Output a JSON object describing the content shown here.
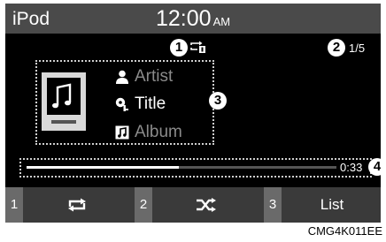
{
  "header": {
    "app_title": "iPod",
    "time": "12:00",
    "ampm": "AM"
  },
  "status": {
    "repeat_icon": "repeat-one-icon",
    "track_counter": "1/5"
  },
  "callouts": [
    "1",
    "2",
    "3",
    "4"
  ],
  "track": {
    "artist": "Artist",
    "title": "Title",
    "album": "Album"
  },
  "progress": {
    "fraction": 0.49,
    "elapsed": "0:33"
  },
  "bottom_bar": {
    "keys": [
      "1",
      "2",
      "3"
    ],
    "repeat_button_icon": "repeat-icon",
    "shuffle_button_icon": "shuffle-icon",
    "list_label": "List"
  },
  "caption": "CMG4K011EE",
  "colors": {
    "screen_bg": "#000000",
    "header_bg": "#4a4a4a",
    "bottom_bg": "#3a3a3a",
    "key_bg": "#6a6a6a"
  }
}
